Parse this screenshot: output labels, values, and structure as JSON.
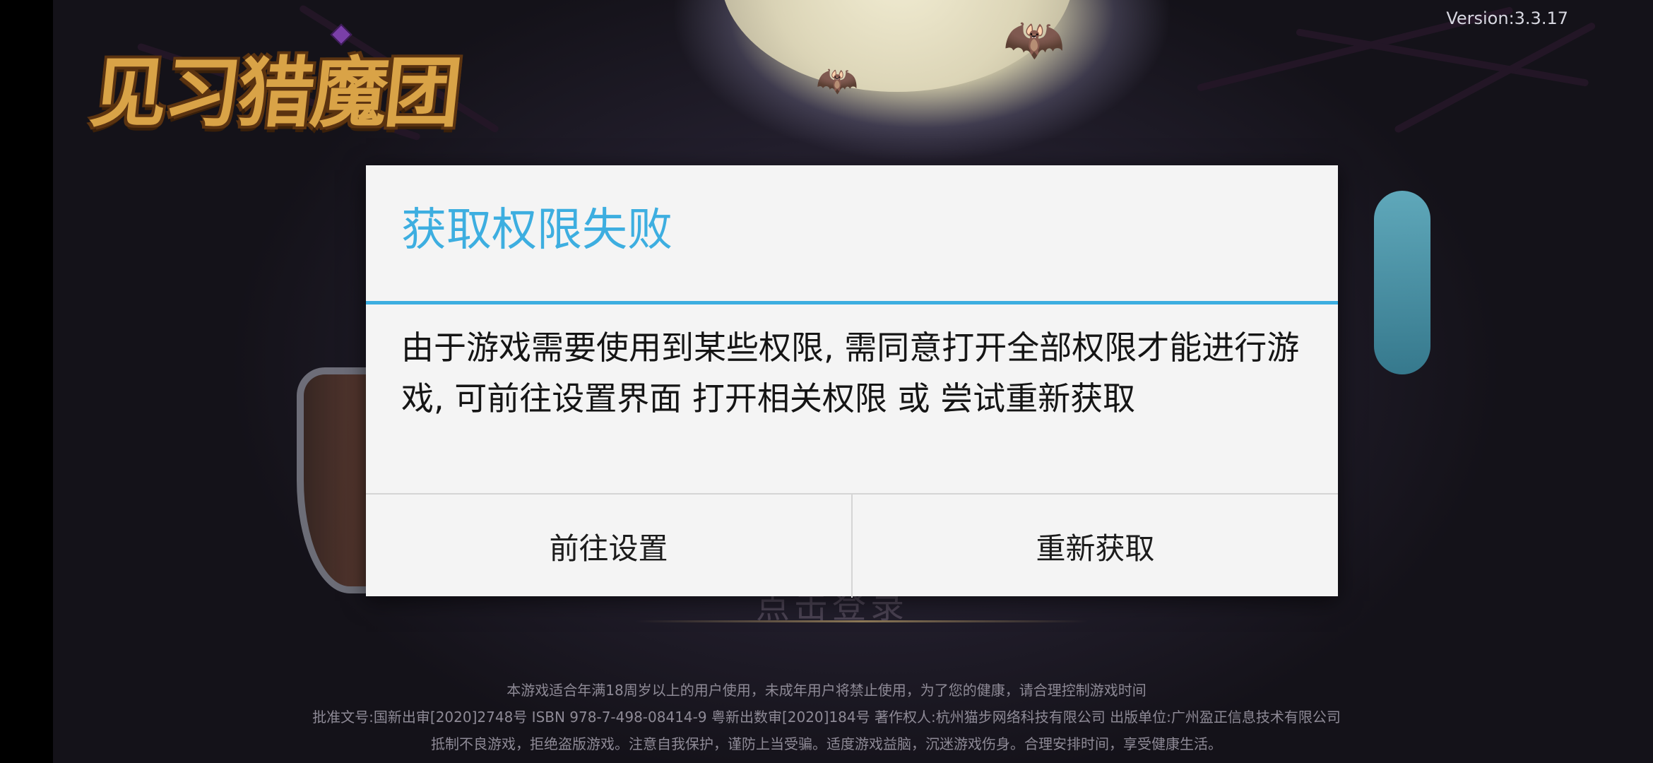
{
  "app": {
    "version_text": "Version:3.3.17",
    "logo_text": "见习猎魔团",
    "start_label_obscured": "点击登录"
  },
  "dialog": {
    "title": "获取权限失败",
    "message": "由于游戏需要使用到某些权限, 需同意打开全部权限才能进行游戏, 可前往设置界面 打开相关权限 或 尝试重新获取",
    "buttons": {
      "settings": "前往设置",
      "retry": "重新获取"
    }
  },
  "footer": {
    "line1": "本游戏适合年满18周岁以上的用户使用，未成年用户将禁止使用，为了您的健康，请合理控制游戏时间",
    "line2": "批准文号:国新出审[2020]2748号 ISBN 978-7-498-08414-9 粤新出数审[2020]184号 著作权人:杭州猫步网络科技有限公司 出版单位:广州盈正信息技术有限公司",
    "line3": "抵制不良游戏，拒绝盗版游戏。注意自我保护，谨防上当受骗。适度游戏益脑，沉迷游戏伤身。合理安排时间，享受健康生活。"
  },
  "colors": {
    "accent": "#3daee0",
    "dialog_bg": "#f4f4f4"
  }
}
